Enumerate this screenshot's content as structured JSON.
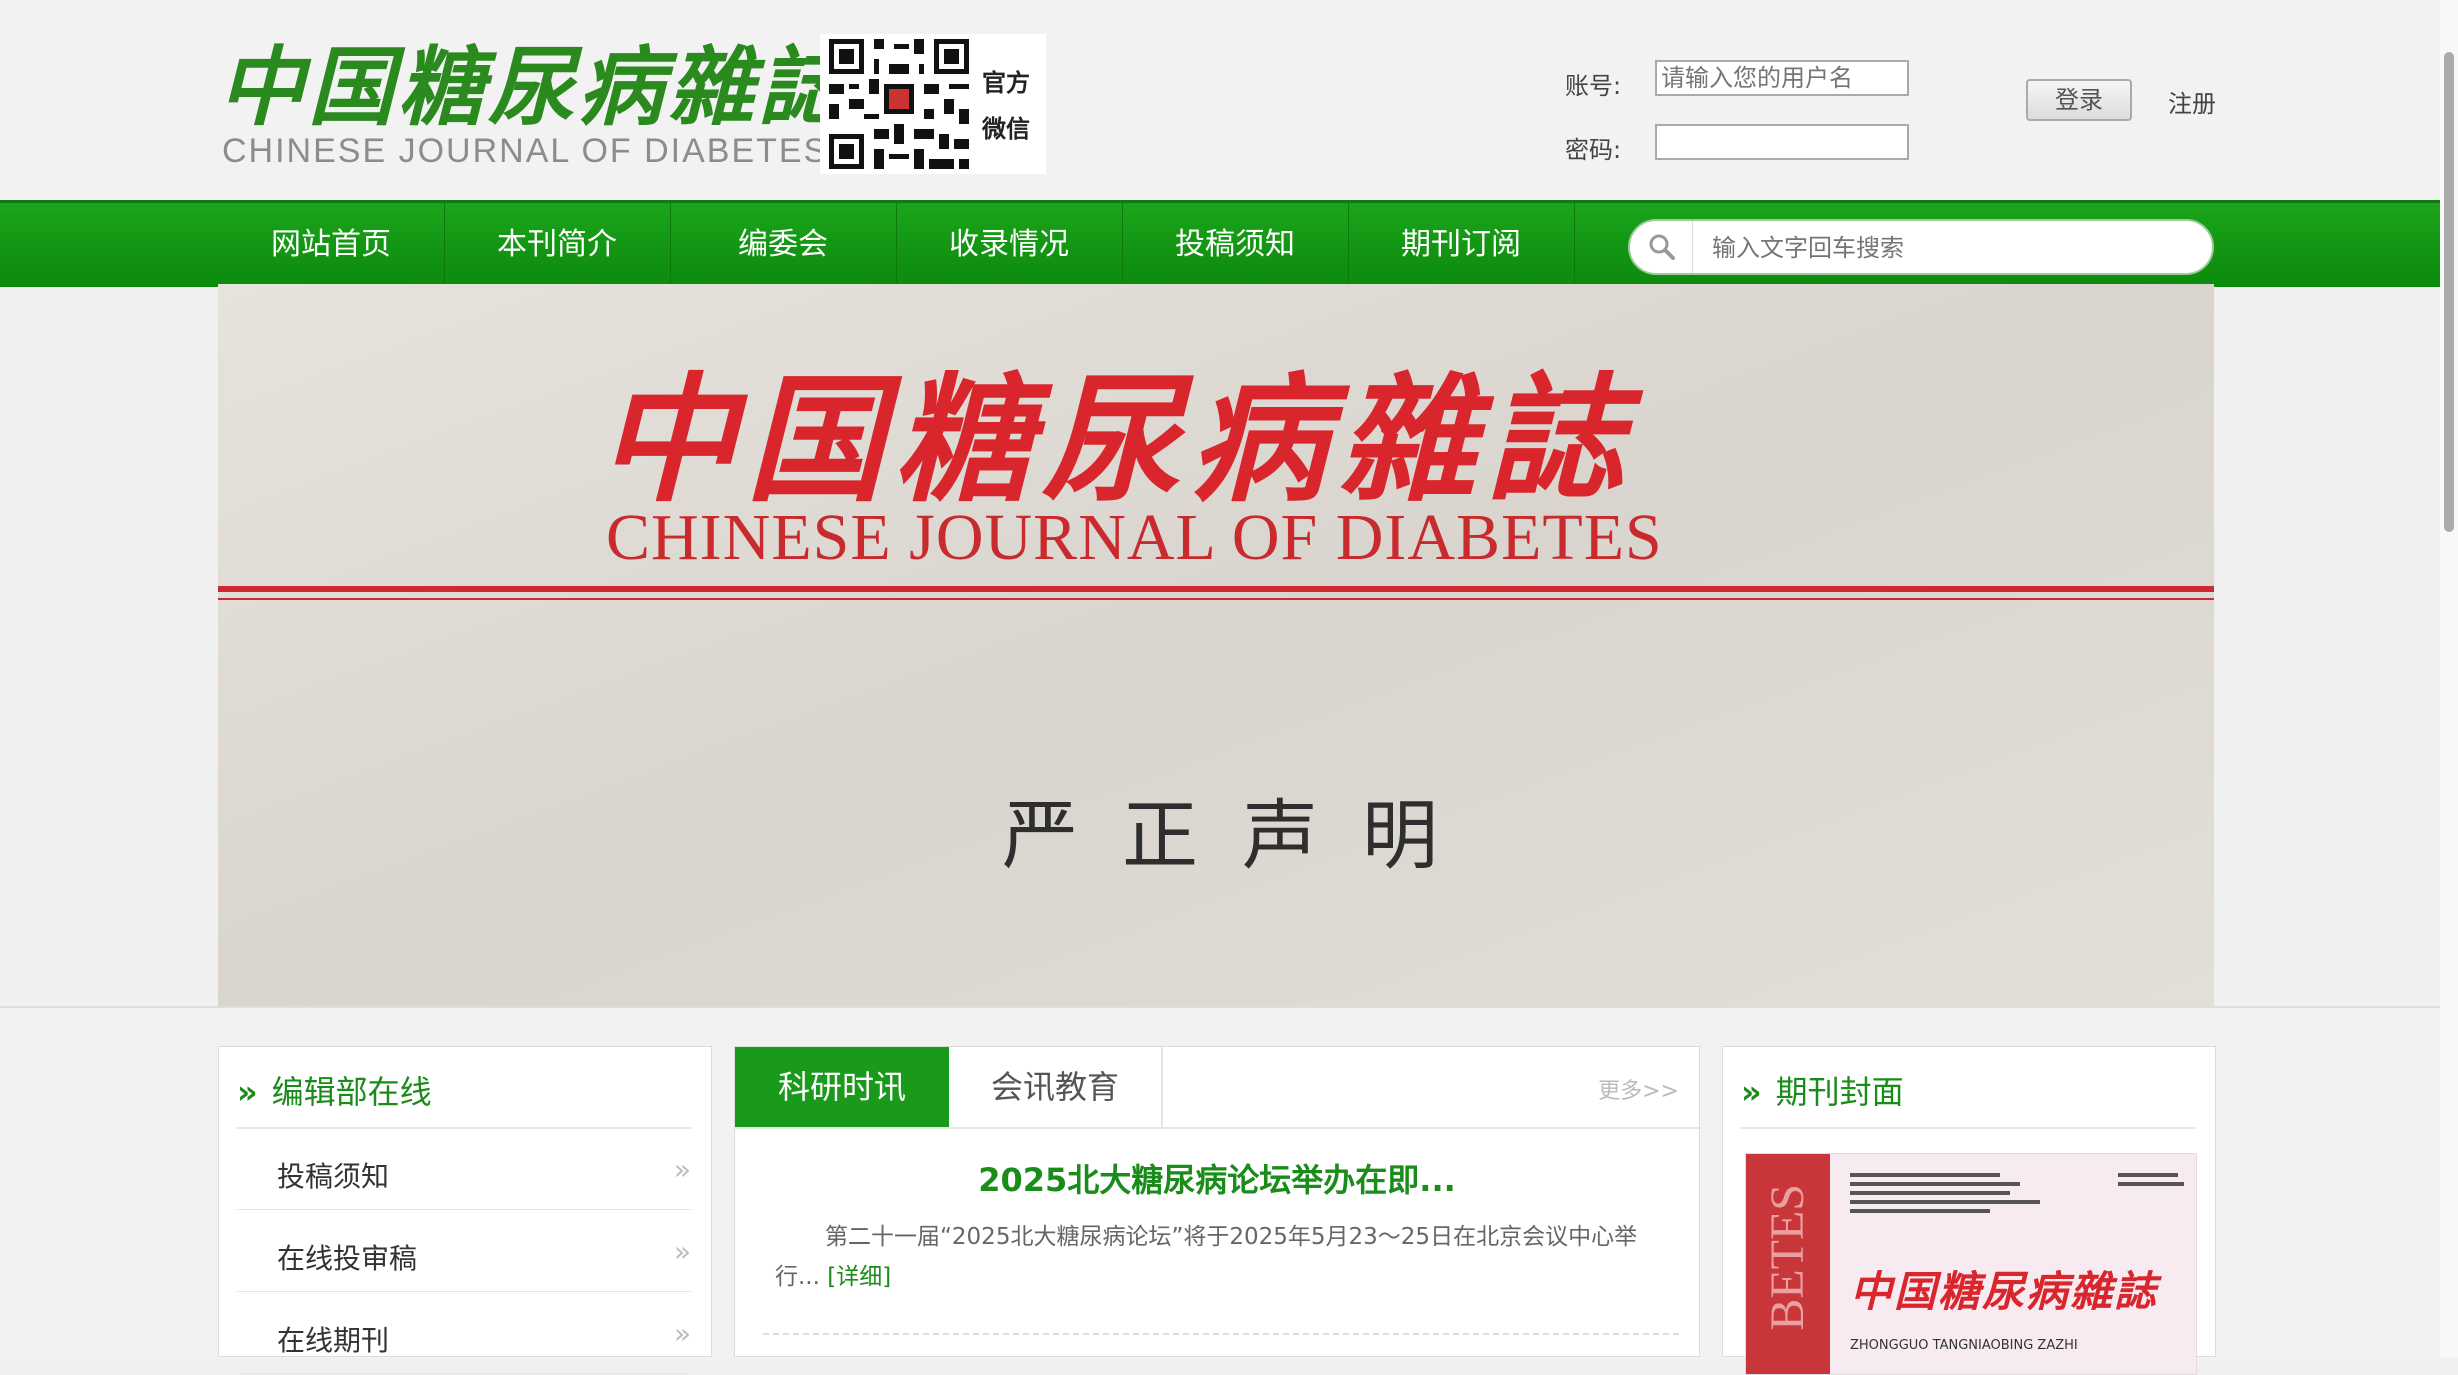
{
  "header": {
    "logo_cn": "中国糖尿病雜誌",
    "logo_en": "CHINESE JOURNAL OF DIABETES",
    "wechat_line1": "官方",
    "wechat_line2": "微信",
    "account_label": "账号:",
    "account_placeholder": "请输入您的用户名",
    "password_label": "密码:",
    "login_button": "登录",
    "register_link": "注册"
  },
  "nav": {
    "items": [
      {
        "label": "网站首页"
      },
      {
        "label": "本刊简介"
      },
      {
        "label": "编委会"
      },
      {
        "label": "收录情况"
      },
      {
        "label": "投稿须知"
      },
      {
        "label": "期刊订阅"
      }
    ],
    "search_placeholder": "输入文字回车搜索"
  },
  "banner": {
    "title_cn": "中国糖尿病雜誌",
    "title_en": "CHINESE JOURNAL OF DIABETES",
    "declaration": "严正声明"
  },
  "editorial": {
    "title": "编辑部在线",
    "items": [
      {
        "label": "投稿须知"
      },
      {
        "label": "在线投审稿"
      },
      {
        "label": "在线期刊"
      }
    ]
  },
  "news": {
    "tabs": [
      {
        "label": "科研时讯"
      },
      {
        "label": "会讯教育"
      }
    ],
    "more": "更多>>",
    "headline": "2025北大糖尿病论坛举办在即...",
    "summary": "第二十一届“2025北大糖尿病论坛”将于2025年5月23～25日在北京会议中心举行...",
    "detail_link": "[详细]"
  },
  "cover_panel": {
    "title": "期刊封面",
    "cover_title_cn": "中国糖尿病雜誌",
    "cover_spine": "BETES",
    "cover_pinyin": "ZHONGGUO TANGNIAOBING ZAZHI"
  },
  "colors": {
    "brand_green": "#1a9a1a",
    "banner_red": "#d8262c"
  }
}
